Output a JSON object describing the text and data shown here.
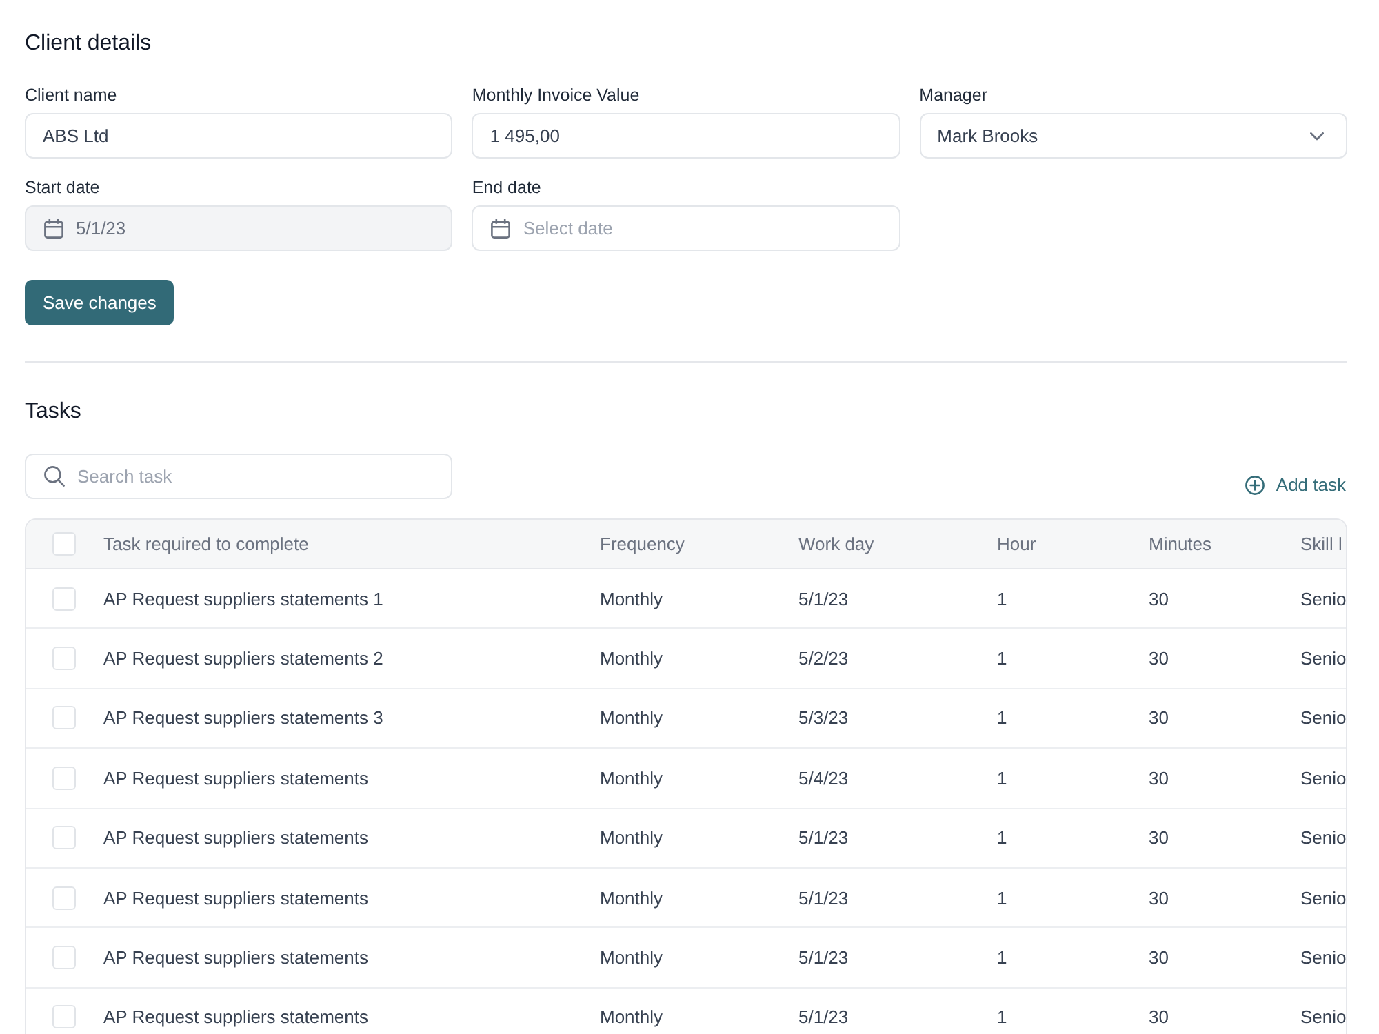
{
  "client_details": {
    "title": "Client details",
    "fields": [
      {
        "kind": "text",
        "label": "Client name",
        "value": "ABS Ltd",
        "disabled": false
      },
      {
        "kind": "text",
        "label": "Monthly Invoice Value",
        "value": "1 495,00",
        "disabled": false
      },
      {
        "kind": "select",
        "label": "Manager",
        "value": "Mark Brooks",
        "disabled": false
      },
      {
        "kind": "date",
        "label": "Start date",
        "value": "5/1/23",
        "disabled": true
      },
      {
        "kind": "date",
        "label": "End date",
        "placeholder": "Select date",
        "disabled": false
      }
    ],
    "save_button": "Save changes"
  },
  "tasks": {
    "title": "Tasks",
    "search": {
      "placeholder": "Search task"
    },
    "add_button": "Add task",
    "table": {
      "select_all": {
        "checked": false
      },
      "columns": [
        "Task required to complete",
        "Frequency",
        "Work day",
        "Hour",
        "Minutes",
        "Skill l"
      ],
      "rows": [
        {
          "checked": false,
          "cells": [
            "AP Request suppliers statements 1",
            "Monthly",
            "5/1/23",
            "1",
            "30",
            "Senio"
          ]
        },
        {
          "checked": false,
          "cells": [
            "AP Request suppliers statements 2",
            "Monthly",
            "5/2/23",
            "1",
            "30",
            "Senio"
          ]
        },
        {
          "checked": false,
          "cells": [
            "AP Request suppliers statements 3",
            "Monthly",
            "5/3/23",
            "1",
            "30",
            "Senio"
          ]
        },
        {
          "checked": false,
          "cells": [
            "AP Request suppliers statements",
            "Monthly",
            "5/4/23",
            "1",
            "30",
            "Senio"
          ]
        },
        {
          "checked": false,
          "cells": [
            "AP Request suppliers statements",
            "Monthly",
            "5/1/23",
            "1",
            "30",
            "Senio"
          ]
        },
        {
          "checked": false,
          "cells": [
            "AP Request suppliers statements",
            "Monthly",
            "5/1/23",
            "1",
            "30",
            "Senio"
          ]
        },
        {
          "checked": false,
          "cells": [
            "AP Request suppliers statements",
            "Monthly",
            "5/1/23",
            "1",
            "30",
            "Senio"
          ]
        },
        {
          "checked": false,
          "cells": [
            "AP Request suppliers statements",
            "Monthly",
            "5/1/23",
            "1",
            "30",
            "Senio"
          ]
        }
      ]
    }
  }
}
